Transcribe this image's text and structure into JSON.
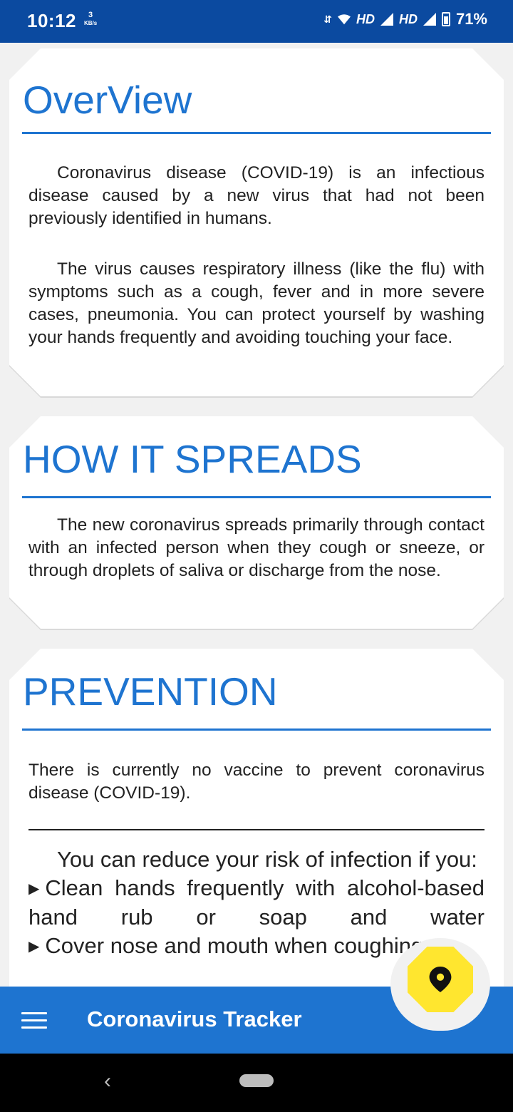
{
  "status_bar": {
    "time": "10:12",
    "speed_value": "3",
    "speed_unit": "KB/s",
    "hd1": "HD",
    "hd2": "HD",
    "battery": "71%"
  },
  "cards": {
    "overview": {
      "title": "OverView",
      "p1": "Coronavirus disease (COVID-19) is an infectious disease caused by a new virus that had not been previously identified in humans.",
      "p2": "The virus causes respiratory illness (like the flu) with symptoms such as a cough, fever and in more severe cases, pneumonia. You can protect yourself by washing your hands frequently and avoiding touching your face."
    },
    "spreads": {
      "title": "HOW IT SPREADS",
      "p1": "The new coronavirus spreads primarily through contact with an infected person when they cough or sneeze, or through droplets of saliva or discharge from the nose."
    },
    "prevention": {
      "title": "PREVENTION",
      "p1": "There is currently no vaccine to prevent coronavirus disease (COVID-19).",
      "lead": "You can reduce your risk of infection if you:",
      "bullet1": "Clean hands frequently with alcohol-based hand rub or soap and water",
      "bullet2": "Cover nose and mouth when coughing"
    }
  },
  "app_bar": {
    "title": "Coronavirus Tracker",
    "fab_icon": "location-pin-icon",
    "menu_icon": "hamburger-menu-icon"
  },
  "colors": {
    "status_bar": "#0b4aa0",
    "accent": "#1e74d0",
    "fab": "#ffe62f"
  }
}
